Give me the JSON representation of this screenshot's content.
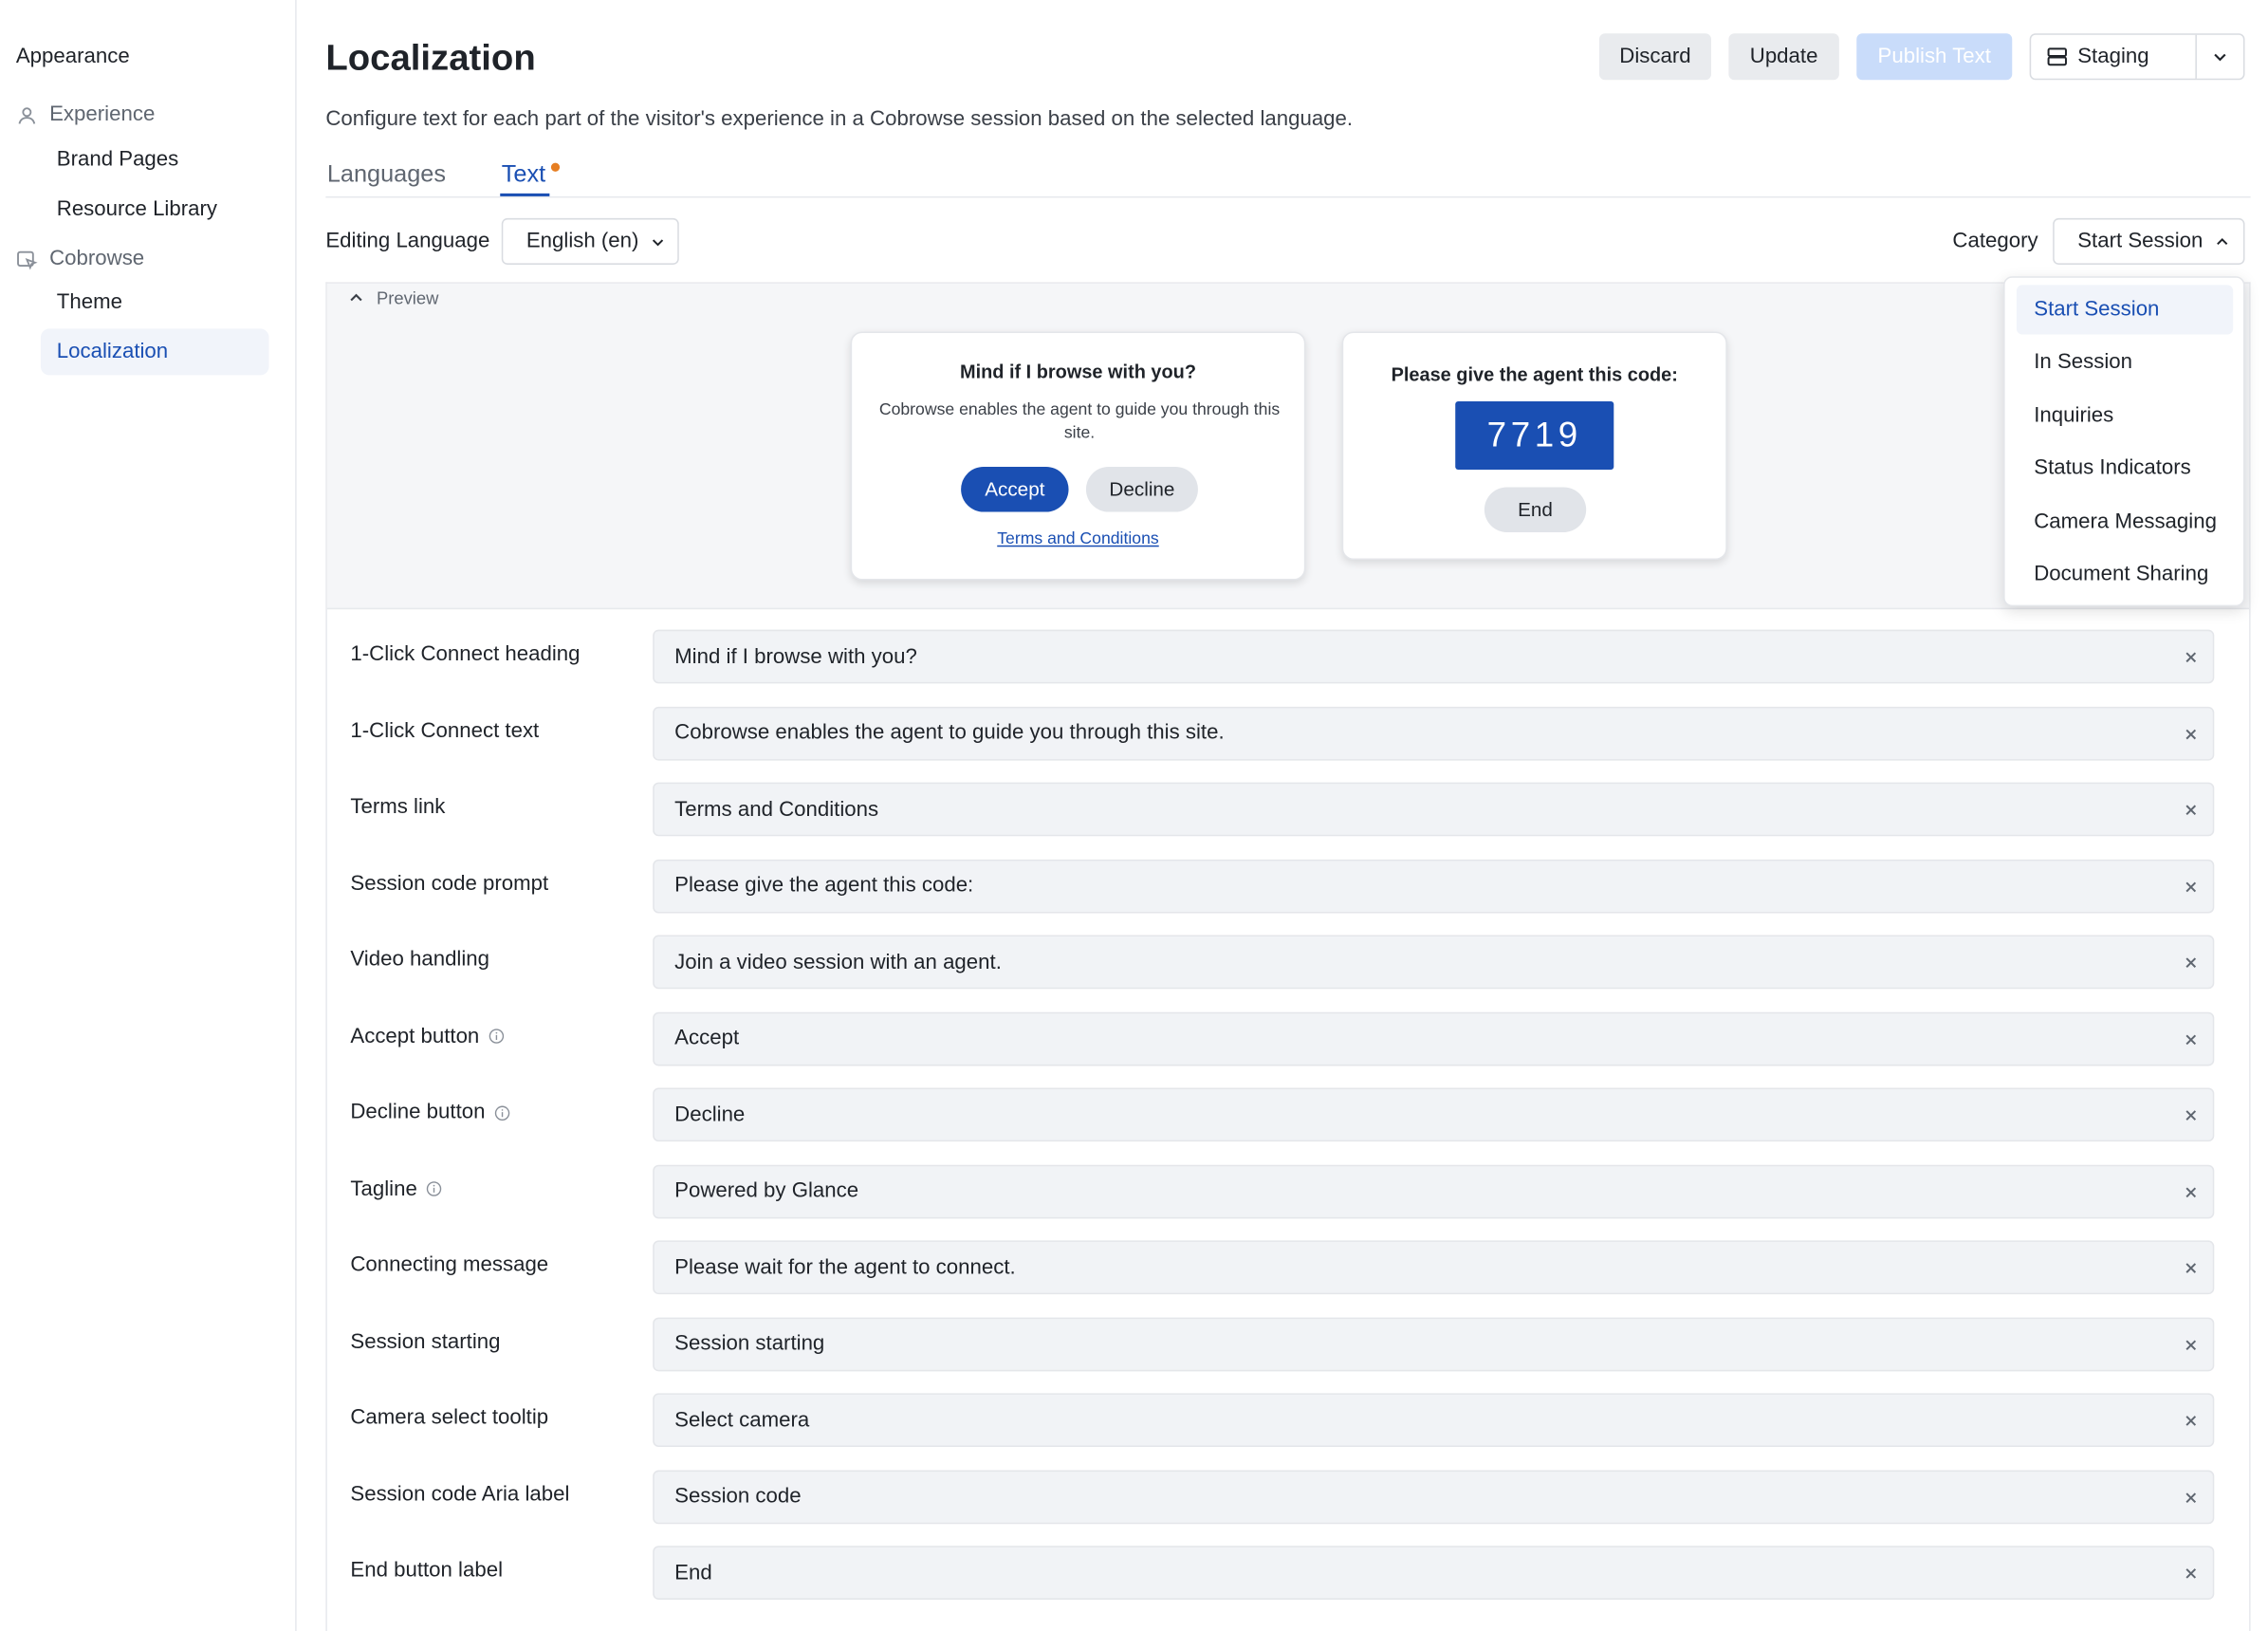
{
  "sidebar": {
    "section": "Appearance",
    "groups": [
      {
        "label": "Experience",
        "icon": "user-icon",
        "items": [
          "Brand Pages",
          "Resource Library"
        ]
      },
      {
        "label": "Cobrowse",
        "icon": "cobrowse-icon",
        "items": [
          "Theme",
          "Localization"
        ]
      }
    ],
    "active_item": "Localization"
  },
  "header": {
    "title": "Localization",
    "subtitle": "Configure text for each part of the visitor's experience in a Cobrowse session based on the selected language.",
    "discard_label": "Discard",
    "update_label": "Update",
    "publish_label": "Publish Text",
    "environment": "Staging"
  },
  "tabs": [
    {
      "label": "Languages",
      "active": false
    },
    {
      "label": "Text",
      "active": true,
      "modified_indicator": true
    }
  ],
  "editing_language": {
    "label": "Editing Language",
    "value": "English (en)"
  },
  "category": {
    "label": "Category",
    "value": "Start Session",
    "options": [
      "Start Session",
      "In Session",
      "Inquiries",
      "Status Indicators",
      "Camera Messaging",
      "Document Sharing"
    ]
  },
  "preview": {
    "toggle_label": "Preview",
    "connect_card": {
      "heading": "Mind if I browse with you?",
      "text": "Cobrowse enables the agent to guide you through this site.",
      "accept": "Accept",
      "decline": "Decline",
      "terms": "Terms and Conditions"
    },
    "code_card": {
      "prompt": "Please give the agent this code:",
      "code": "7719",
      "end": "End"
    }
  },
  "fields": [
    {
      "label": "1-Click Connect heading",
      "value": "Mind if I browse with you?",
      "info": false
    },
    {
      "label": "1-Click Connect text",
      "value": "Cobrowse enables the agent to guide you through this site.",
      "info": false
    },
    {
      "label": "Terms link",
      "value": "Terms and Conditions",
      "info": false
    },
    {
      "label": "Session code prompt",
      "value": "Please give the agent this code:",
      "info": false
    },
    {
      "label": "Video handling",
      "value": "Join a video session with an agent.",
      "info": false
    },
    {
      "label": "Accept button",
      "value": "Accept",
      "info": true
    },
    {
      "label": "Decline button",
      "value": "Decline",
      "info": true
    },
    {
      "label": "Tagline",
      "value": "Powered by Glance",
      "info": true
    },
    {
      "label": "Connecting message",
      "value": "Please wait for the agent to connect.",
      "info": false
    },
    {
      "label": "Session starting",
      "value": "Session starting",
      "info": false
    },
    {
      "label": "Camera select tooltip",
      "value": "Select camera",
      "info": false
    },
    {
      "label": "Session code Aria label",
      "value": "Session code",
      "info": false
    },
    {
      "label": "End button label",
      "value": "End",
      "info": false
    }
  ],
  "colors": {
    "accent": "#1a4fb3",
    "modified_dot": "#e67e22",
    "publish_disabled": "#c9dcfa"
  }
}
